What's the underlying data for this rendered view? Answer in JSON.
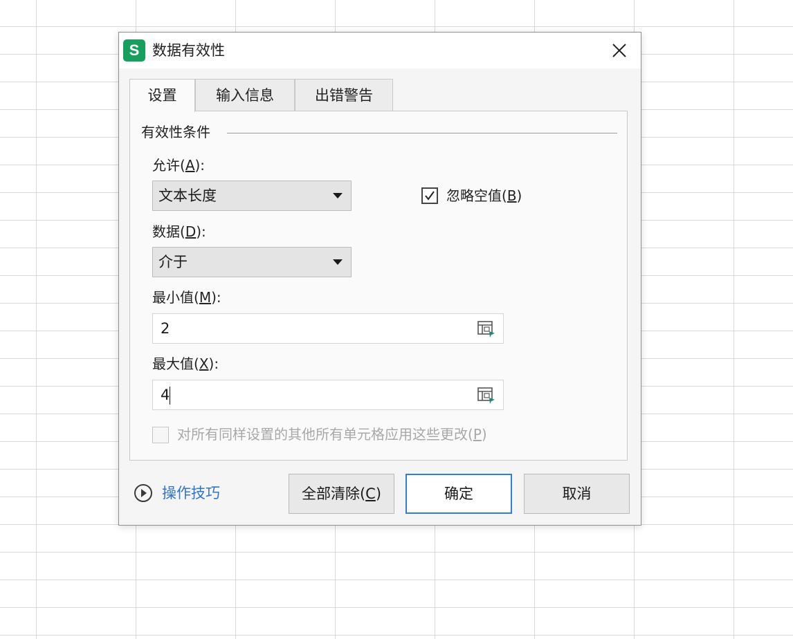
{
  "dialog": {
    "title": "数据有效性",
    "app_icon_letter": "S",
    "brand_color": "#17a05d"
  },
  "tabs": [
    {
      "label": "设置",
      "active": true
    },
    {
      "label": "输入信息",
      "active": false
    },
    {
      "label": "出错警告",
      "active": false
    }
  ],
  "group": {
    "title": "有效性条件"
  },
  "allow": {
    "label": "允许(",
    "mnemonic": "A",
    "label_tail": "):",
    "value": "文本长度"
  },
  "ignore_blank": {
    "label": "忽略空值(",
    "mnemonic": "B",
    "label_tail": ")",
    "checked": true
  },
  "data_field": {
    "label": "数据(",
    "mnemonic": "D",
    "label_tail": "):",
    "value": "介于"
  },
  "min_value": {
    "label": "最小值(",
    "mnemonic": "M",
    "label_tail": "):",
    "value": "2"
  },
  "max_value": {
    "label": "最大值(",
    "mnemonic": "X",
    "label_tail": "):",
    "value": "4"
  },
  "apply_all": {
    "label": "对所有同样设置的其他所有单元格应用这些更改(",
    "mnemonic": "P",
    "label_tail": ")",
    "checked": false,
    "disabled": true
  },
  "footer": {
    "tips_label": "操作技巧",
    "clear_label": "全部清除(",
    "clear_mnemonic": "C",
    "clear_tail": ")",
    "ok_label": "确定",
    "cancel_label": "取消",
    "accent_color": "#2f7fd8",
    "link_color": "#2f74d0"
  }
}
